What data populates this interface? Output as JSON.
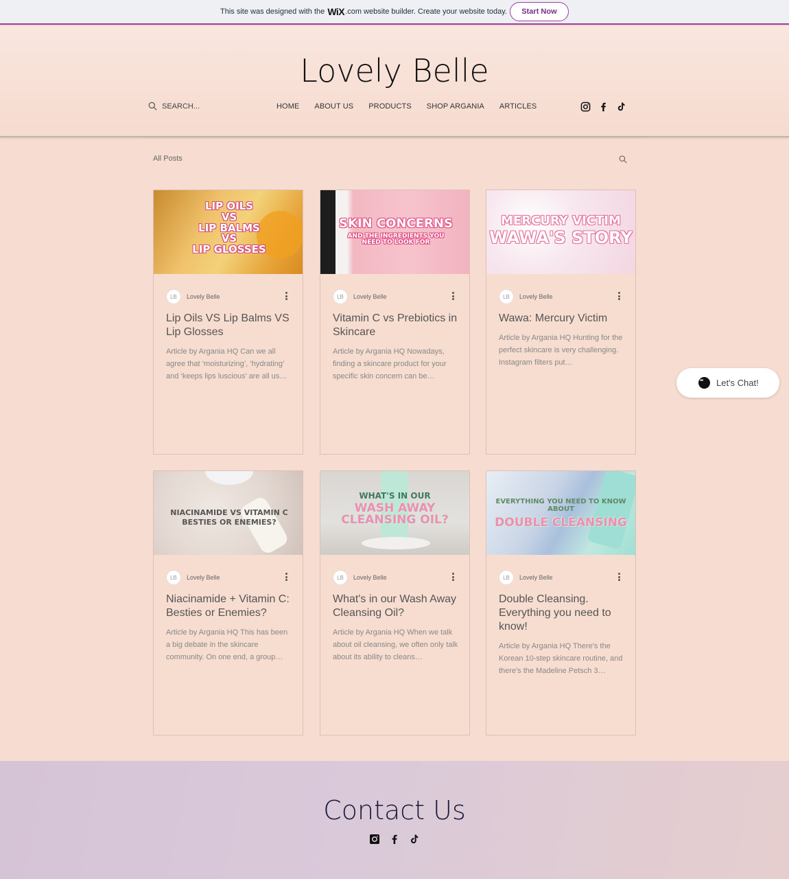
{
  "banner": {
    "text_before": "This site was designed with the",
    "wix_logo": "WiX",
    "text_after": ".com website builder. Create your website today.",
    "start_label": "Start Now"
  },
  "header": {
    "site_title": "Lovely Belle",
    "search_placeholder": "SEARCH...",
    "nav": [
      "HOME",
      "ABOUT US",
      "PRODUCTS",
      "SHOP ARGANIA",
      "ARTICLES"
    ],
    "social_icons": [
      "instagram-icon",
      "facebook-icon",
      "tiktok-icon"
    ]
  },
  "blog": {
    "filter_label": "All Posts",
    "posts": [
      {
        "thumb_text": [
          "LIP OILS",
          "VS",
          "LIP BALMS",
          "VS",
          "LIP GLOSSES"
        ],
        "author": "Lovely Belle",
        "title": "Lip Oils VS Lip Balms VS Lip Glosses",
        "excerpt": "Article by Argania HQ Can we all agree that ‘moisturizing’, ‘hydrating’ and ‘keeps lips luscious’ are all us…"
      },
      {
        "thumb_text": [
          "SKIN CONCERNS",
          "AND THE INGREDIENTS YOU",
          "NEED TO LOOK FOR"
        ],
        "author": "Lovely Belle",
        "title": "Vitamin C vs Prebiotics in Skincare",
        "excerpt": "Article by Argania HQ Nowadays, finding a skincare product for your specific skin concern can be…"
      },
      {
        "thumb_text": [
          "MERCURY VICTIM",
          "WAWA'S STORY"
        ],
        "author": "Lovely Belle",
        "title": "Wawa: Mercury Victim",
        "excerpt": "Article by Argania HQ Hunting for the perfect skincare is very challenging. Instagram filters put…"
      },
      {
        "thumb_text": [
          "NIACINAMIDE VS VITAMIN C",
          "BESTIES OR ENEMIES?"
        ],
        "author": "Lovely Belle",
        "title": "Niacinamide + Vitamin C: Besties or Enemies?",
        "excerpt": "Article by Argania HQ This has been a big debate in the skincare community. On one end, a group…"
      },
      {
        "thumb_text": [
          "WHAT'S IN OUR",
          "WASH AWAY",
          "CLEANSING OIL?"
        ],
        "author": "Lovely Belle",
        "title": "What's in our Wash Away Cleansing Oil?",
        "excerpt": "Article by Argania HQ When we talk about oil cleansing, we often only talk about its ability to cleans…"
      },
      {
        "thumb_text": [
          "EVERYTHING YOU NEED TO KNOW ABOUT",
          "DOUBLE CLEANSING"
        ],
        "author": "Lovely Belle",
        "title": "Double Cleansing. Everything you need to know!",
        "excerpt": "Article by Argania HQ There's the Korean 10-step skincare routine, and there's the Madeline Petsch 3…"
      }
    ]
  },
  "chat": {
    "label": "Let's Chat!"
  },
  "footer": {
    "title": "Contact Us",
    "social_icons": [
      "instagram-icon",
      "facebook-icon",
      "tiktok-icon"
    ]
  },
  "colors": {
    "page_bg": "#f6dcd1",
    "banner_accent": "#9a3fa0",
    "footer_bg": "#d7c6d7"
  }
}
